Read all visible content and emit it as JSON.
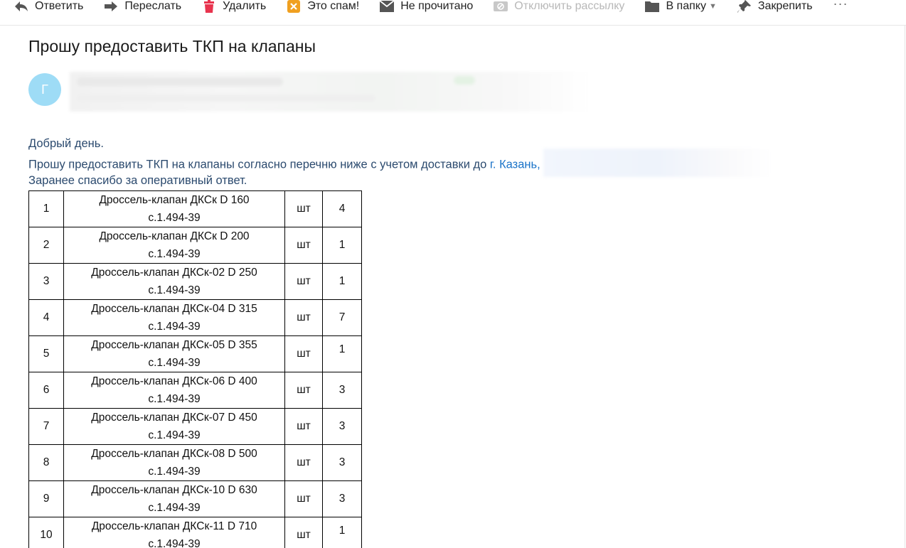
{
  "toolbar": {
    "reply": "Ответить",
    "forward": "Переслать",
    "delete": "Удалить",
    "spam": "Это спам!",
    "unread": "Не прочитано",
    "unsubscribe": "Отключить рассылку",
    "to_folder": "В папку",
    "pin": "Закрепить",
    "more": "···"
  },
  "message": {
    "subject": "Прошу предоставить ТКП на клапаны",
    "sender_initial": "Г",
    "greeting": "Добрый день.",
    "request_text": "Прошу предоставить ТКП на клапаны согласно перечню ниже с учетом доставки до ",
    "city_link": "г. Казань,",
    "thanks": "Заранее спасибо за оперативный ответ."
  },
  "colors": {
    "avatar": "#9edcf6",
    "link": "#1a73c8",
    "body_text": "#2b4a6e",
    "delete_icon": "#e8344e",
    "spam_icon": "#f0a020"
  },
  "items": [
    {
      "num": "1",
      "name": "Дроссель-клапан ДКСк D 160",
      "code": "с.1.494-39",
      "unit": "шт",
      "qty": "4"
    },
    {
      "num": "2",
      "name": "Дроссель-клапан ДКСк D 200",
      "code": "с.1.494-39",
      "unit": "шт",
      "qty": "1"
    },
    {
      "num": "3",
      "name": "Дроссель-клапан ДКСк-02 D 250",
      "code": "с.1.494-39",
      "unit": "шт",
      "qty": "1"
    },
    {
      "num": "4",
      "name": "Дроссель-клапан ДКСк-04 D 315",
      "code": "с.1.494-39",
      "unit": "шт",
      "qty": "7"
    },
    {
      "num": "5",
      "name": "Дроссель-клапан ДКСк-05 D 355",
      "code": "с.1.494-39",
      "unit": "шт",
      "qty": "1"
    },
    {
      "num": "6",
      "name": "Дроссель-клапан ДКСк-06 D 400",
      "code": "с.1.494-39",
      "unit": "шт",
      "qty": "3"
    },
    {
      "num": "7",
      "name": "Дроссель-клапан ДКСк-07 D 450",
      "code": "с.1.494-39",
      "unit": "шт",
      "qty": "3"
    },
    {
      "num": "8",
      "name": "Дроссель-клапан ДКСк-08 D 500",
      "code": "с.1.494-39",
      "unit": "шт",
      "qty": "3"
    },
    {
      "num": "9",
      "name": "Дроссель-клапан ДКСк-10 D 630",
      "code": "с.1.494-39",
      "unit": "шт",
      "qty": "3"
    },
    {
      "num": "10",
      "name": "Дроссель-клапан ДКСк-11 D 710",
      "code": "с.1.494-39",
      "unit": "шт",
      "qty": "1"
    }
  ]
}
